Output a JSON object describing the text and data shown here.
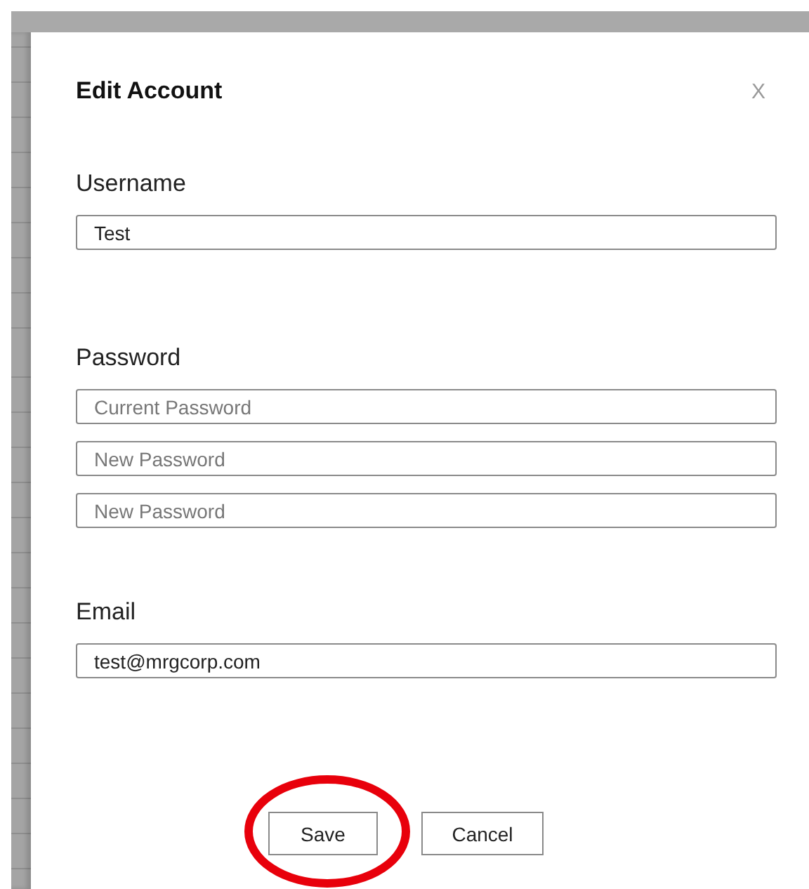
{
  "dialog": {
    "title": "Edit Account",
    "close": "X"
  },
  "sections": [
    {
      "label": "Username",
      "fields": [
        {
          "value": "Test"
        }
      ]
    },
    {
      "label": "Password",
      "fields": [
        {
          "placeholder": "Current Password"
        },
        {
          "placeholder": "New Password"
        },
        {
          "placeholder": "New Password"
        }
      ]
    },
    {
      "label": "Email",
      "fields": [
        {
          "value": "test@mrgcorp.com"
        }
      ]
    }
  ],
  "buttons": [
    {
      "label": "Save",
      "highlighted": true
    },
    {
      "label": "Cancel",
      "highlighted": false
    }
  ]
}
